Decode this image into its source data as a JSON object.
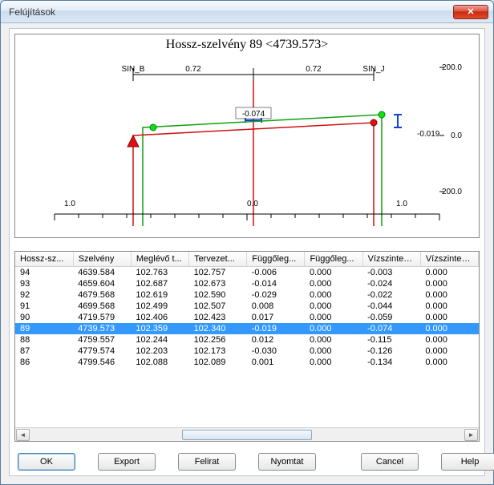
{
  "window": {
    "title": "Felújítások",
    "close_glyph": "✕"
  },
  "chart_data": {
    "type": "line",
    "title": "Hossz-szelvény 89 <4739.573>",
    "top_labels": {
      "left": "SIN_B",
      "right": "SIN_J"
    },
    "dims": {
      "seg1": "0.72",
      "seg2": "0.72"
    },
    "center": {
      "offset_label": "-0.074",
      "right_label": "-0.019"
    },
    "y2_ticks": [
      "200.0",
      "0.0",
      "-200.0"
    ],
    "x_ticks": [
      "1.0",
      "0.0",
      "1.0"
    ],
    "series": [
      {
        "name": "meglevo",
        "color": "#d01010"
      },
      {
        "name": "tervezett",
        "color": "#10a010"
      }
    ]
  },
  "table": {
    "headers": [
      "Hossz-sz...",
      "Szelvény",
      "Meglévő t...",
      "Tervezet...",
      "Függőleg...",
      "Függőleg...",
      "Vízszintes...",
      "Vízszintes..."
    ],
    "rows": [
      {
        "id": "94",
        "szelveny": "4639.584",
        "meglevo": "102.763",
        "tervezett": "102.757",
        "fugg1": "-0.006",
        "fugg2": "0.000",
        "viz1": "-0.003",
        "viz2": "0.000"
      },
      {
        "id": "93",
        "szelveny": "4659.604",
        "meglevo": "102.687",
        "tervezett": "102.673",
        "fugg1": "-0.014",
        "fugg2": "0.000",
        "viz1": "-0.024",
        "viz2": "0.000"
      },
      {
        "id": "92",
        "szelveny": "4679.568",
        "meglevo": "102.619",
        "tervezett": "102.590",
        "fugg1": "-0.029",
        "fugg2": "0.000",
        "viz1": "-0.022",
        "viz2": "0.000"
      },
      {
        "id": "91",
        "szelveny": "4699.568",
        "meglevo": "102.499",
        "tervezett": "102.507",
        "fugg1": "0.008",
        "fugg2": "0.000",
        "viz1": "-0.044",
        "viz2": "0.000"
      },
      {
        "id": "90",
        "szelveny": "4719.579",
        "meglevo": "102.406",
        "tervezett": "102.423",
        "fugg1": "0.017",
        "fugg2": "0.000",
        "viz1": "-0.059",
        "viz2": "0.000"
      },
      {
        "id": "89",
        "szelveny": "4739.573",
        "meglevo": "102.359",
        "tervezett": "102.340",
        "fugg1": "-0.019",
        "fugg2": "0.000",
        "viz1": "-0.074",
        "viz2": "0.000",
        "selected": true
      },
      {
        "id": "88",
        "szelveny": "4759.557",
        "meglevo": "102.244",
        "tervezett": "102.256",
        "fugg1": "0.012",
        "fugg2": "0.000",
        "viz1": "-0.115",
        "viz2": "0.000"
      },
      {
        "id": "87",
        "szelveny": "4779.574",
        "meglevo": "102.203",
        "tervezett": "102.173",
        "fugg1": "-0.030",
        "fugg2": "0.000",
        "viz1": "-0.126",
        "viz2": "0.000"
      },
      {
        "id": "86",
        "szelveny": "4799.546",
        "meglevo": "102.088",
        "tervezett": "102.089",
        "fugg1": "0.001",
        "fugg2": "0.000",
        "viz1": "-0.134",
        "viz2": "0.000"
      }
    ]
  },
  "buttons": {
    "ok": "OK",
    "export": "Export",
    "felirat": "Felirat",
    "nyomtat": "Nyomtat",
    "cancel": "Cancel",
    "help": "Help"
  }
}
